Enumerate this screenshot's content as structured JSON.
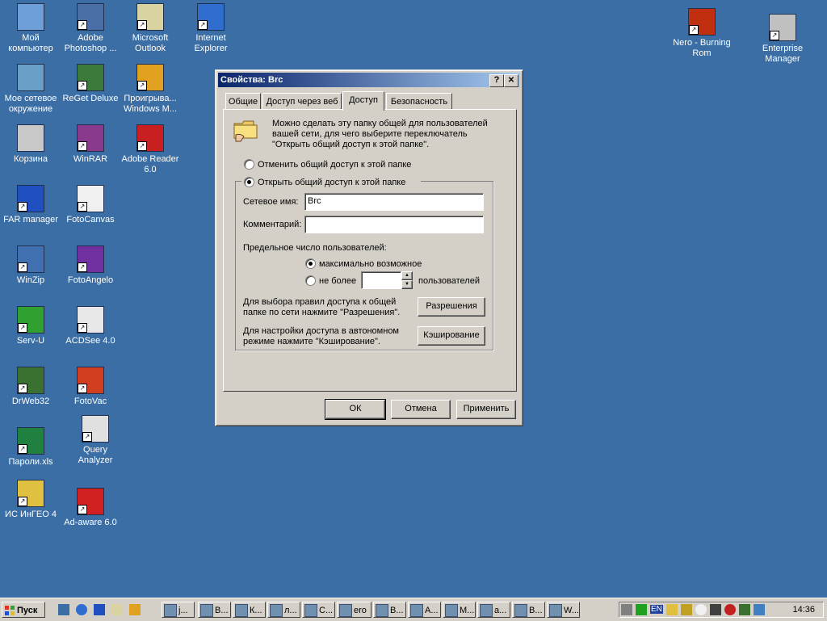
{
  "desktop": {
    "icons": [
      {
        "label": "Мой\nкомпьютер",
        "icon": "my-computer-icon",
        "color": "#6f9fd8"
      },
      {
        "label": "Adobe\nPhotoshop ...",
        "icon": "photoshop-icon",
        "color": "#4a6fa8"
      },
      {
        "label": "Microsoft\nOutlook",
        "icon": "outlook-icon",
        "color": "#d9d3a2"
      },
      {
        "label": "Internet\nExplorer",
        "icon": "ie-icon",
        "color": "#2f6ecf"
      },
      {
        "label": "Мое сетевое\nокружение",
        "icon": "network-icon",
        "color": "#6aa0c8"
      },
      {
        "label": "ReGet Deluxe",
        "icon": "reget-icon",
        "color": "#3b7a3b"
      },
      {
        "label": "Проигрыва...\nWindows M...",
        "icon": "media-player-icon",
        "color": "#e0a020"
      },
      {
        "label": "Корзина",
        "icon": "recycle-bin-icon",
        "color": "#c8c8c8"
      },
      {
        "label": "WinRAR",
        "icon": "winrar-icon",
        "color": "#8a3a8a"
      },
      {
        "label": "Adobe Reader\n6.0",
        "icon": "adobe-reader-icon",
        "color": "#c82020"
      },
      {
        "label": "FAR manager",
        "icon": "far-manager-icon",
        "color": "#2050c0"
      },
      {
        "label": "FotoCanvas",
        "icon": "fotocanvas-icon",
        "color": "#f0f0f0"
      },
      {
        "label": "WinZip",
        "icon": "winzip-icon",
        "color": "#4070b0"
      },
      {
        "label": "FotoAngelo",
        "icon": "fotoangelo-icon",
        "color": "#7030a0"
      },
      {
        "label": "Serv-U",
        "icon": "serv-u-icon",
        "color": "#30a030"
      },
      {
        "label": "ACDSee 4.0",
        "icon": "acdsee-icon",
        "color": "#e8e8e8"
      },
      {
        "label": "DrWeb32",
        "icon": "drweb-icon",
        "color": "#3a7030"
      },
      {
        "label": "FotoVac",
        "icon": "fotovac-icon",
        "color": "#d04020"
      },
      {
        "label": "Пароли.xls",
        "icon": "excel-file-icon",
        "color": "#208040"
      },
      {
        "label": "Query\nAnalyzer",
        "icon": "query-analyzer-icon",
        "color": "#e0e0e0"
      },
      {
        "label": "ИС ИнГЕО 4",
        "icon": "ingeo-icon",
        "color": "#e0c040"
      },
      {
        "label": "Ad-aware 6.0",
        "icon": "adaware-icon",
        "color": "#d02020"
      },
      {
        "label": "Nero - Burning\nRom",
        "icon": "nero-icon",
        "color": "#c03010"
      },
      {
        "label": "Enterprise\nManager",
        "icon": "enterprise-manager-icon",
        "color": "#c0c0c0"
      }
    ]
  },
  "dialog": {
    "title": "Свойства: Brc",
    "help_label": "?",
    "close_label": "✕",
    "tabs": [
      {
        "label": "Общие"
      },
      {
        "label": "Доступ через веб"
      },
      {
        "label": "Доступ"
      },
      {
        "label": "Безопасность"
      }
    ],
    "intro_text": "Можно сделать эту папку общей для пользователей вашей сети, для чего выберите переключатель \"Открыть общий доступ к этой папке\".",
    "radio_unshare": "Отменить общий доступ к этой папке",
    "radio_share": "Открыть общий доступ к этой папке",
    "share_name_label": "Сетевое имя:",
    "share_name_value": "Brc",
    "comment_label": "Комментарий:",
    "comment_value": "",
    "user_limit_label": "Предельное число пользователей:",
    "radio_max": "максимально возможное",
    "radio_no_more": "не более",
    "users_suffix": "пользователей",
    "perm_text": "Для выбора правил доступа к общей папке по сети нажмите \"Разрешения\".",
    "perm_button": "Разрешения",
    "cache_text": "Для настройки доступа в автономном режиме нажмите \"Кэширование\".",
    "cache_button": "Кэширование",
    "ok": "ОК",
    "cancel": "Отмена",
    "apply": "Применить"
  },
  "taskbar": {
    "start_label": "Пуск",
    "items": [
      {
        "label": "j...",
        "icon": "app-icon"
      },
      {
        "label": "В...",
        "icon": "app-icon"
      },
      {
        "label": "К...",
        "icon": "search-icon"
      },
      {
        "label": "л...",
        "icon": "search-icon"
      },
      {
        "label": "С...",
        "icon": "gear-icon"
      },
      {
        "label": "ero",
        "icon": "search-icon"
      },
      {
        "label": "В...",
        "icon": "app-icon"
      },
      {
        "label": "А...",
        "icon": "search-icon"
      },
      {
        "label": "М...",
        "icon": "app-icon"
      },
      {
        "label": "а...",
        "icon": "word-icon"
      },
      {
        "label": "В...",
        "icon": "app-icon"
      },
      {
        "label": "W...",
        "icon": "help-icon"
      }
    ],
    "clock": "14:36",
    "lang": "EN"
  }
}
